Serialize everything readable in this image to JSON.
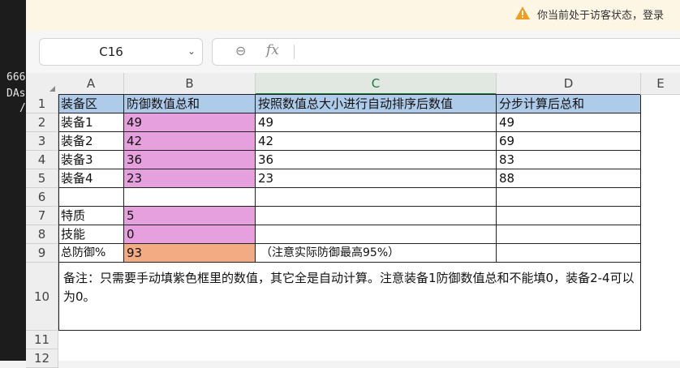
{
  "left_strip": {
    "lines": [
      "666",
      "DAs",
      "/"
    ]
  },
  "notice": {
    "text": "你当前处于访客状态，登录"
  },
  "formula_bar": {
    "cell_ref": "C16",
    "fx_label": "fx",
    "formula": ""
  },
  "columns": [
    "A",
    "B",
    "C",
    "D",
    "E"
  ],
  "rows": [
    "1",
    "2",
    "3",
    "4",
    "5",
    "6",
    "7",
    "8",
    "9",
    "10",
    "11",
    "12"
  ],
  "table": {
    "header": [
      "装备区",
      "防御数值总和",
      "按照数值总大小进行自动排序后数值",
      "分步计算后总和"
    ],
    "data_rows": [
      [
        "装备1",
        "49",
        "49",
        "49"
      ],
      [
        "装备2",
        "42",
        "42",
        "69"
      ],
      [
        "装备3",
        "36",
        "36",
        "83"
      ],
      [
        "装备4",
        "23",
        "23",
        "88"
      ]
    ],
    "trait_label": "特质",
    "trait_value": "5",
    "skill_label": "技能",
    "skill_value": "0",
    "total_label": "总防御%",
    "total_value": "93",
    "total_note": "（注意实际防御最高95%）",
    "remark": "备注：只需要手动填紫色框里的数值，其它全是自动计算。注意装备1防御数值总和不能填0，装备2-4可以为0。"
  },
  "colors": {
    "header_fill": "#aecbea",
    "input_fill": "#e6a0dd",
    "total_fill": "#f3ab84",
    "selected_col": "#1d7a3d"
  }
}
